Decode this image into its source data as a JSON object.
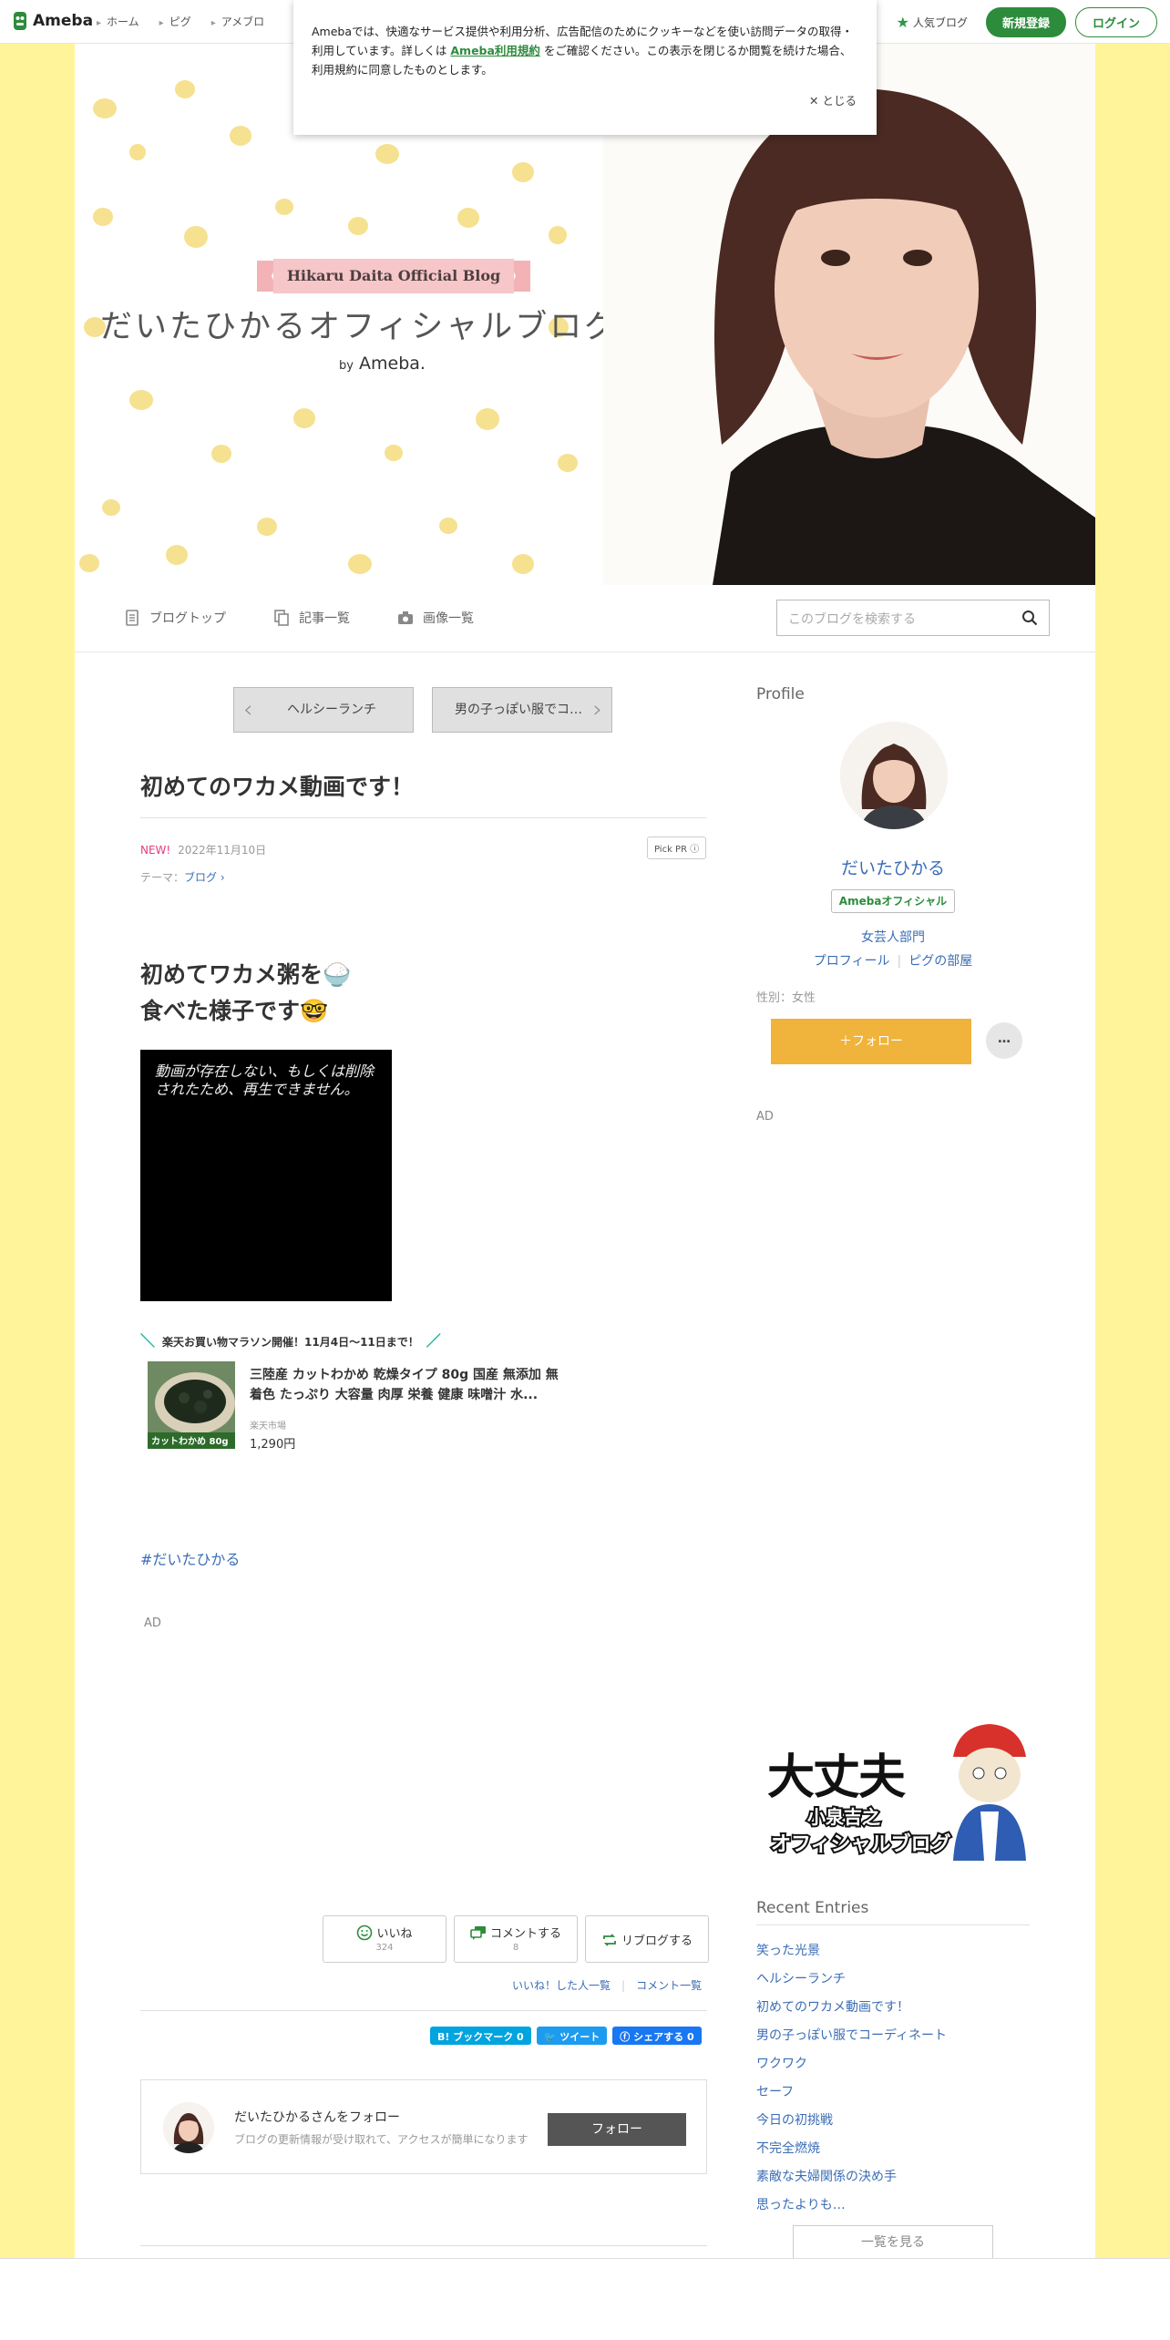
{
  "topbar": {
    "logo": "Ameba",
    "nav": [
      "ホーム",
      "ピグ",
      "アメブロ"
    ],
    "popular": "人気ブログ",
    "signup": "新規登録",
    "login": "ログイン"
  },
  "cookie": {
    "text1": "Amebaでは、快適なサービス提供や利用分析、広告配信のためにクッキーなどを使い訪問データの取得・利用しています。詳しくは",
    "link": "Ameba利用規約",
    "text2": "をご確認ください。この表示を閉じるか閲覧を続けた場合、利用規約に同意したものとします。",
    "close": "✕ とじる"
  },
  "header": {
    "ribbon": "Hikaru Daita Official Blog",
    "title": "だいたひかるオフィシャルブログ",
    "by": "by",
    "ameba": "Ameba."
  },
  "blognav": {
    "top": "ブログトップ",
    "articles": "記事一覧",
    "images": "画像一覧",
    "search_placeholder": "このブログを検索する"
  },
  "entry": {
    "prev": "ヘルシーランチ",
    "next": "男の子っぽい服でコ…",
    "title": "初めてのワカメ動画です！",
    "new": "NEW!",
    "date": "2022年11月10日",
    "pickpr": "Pick PR ⓘ",
    "theme_label": "テーマ：",
    "theme": "ブログ ›",
    "line1": "初めてワカメ粥を🍚",
    "line2": "食べた様子です🤓",
    "video_msg": "動画が存在しない、もしくは削除されたため、再生できません。",
    "rakuten_head": "楽天お買い物マラソン開催！11月4日～11日まで！",
    "product_name": "三陸産 カットわかめ 乾燥タイプ 80g 国産 無添加 無着色 たっぷり 大容量 肉厚 栄養 健康 味噌汁 水...",
    "product_shop": "楽天市場",
    "product_price": "1,290円",
    "product_img_label": "カットわかめ 80g",
    "hashtag": "#だいたひかる",
    "ad": "AD",
    "like": "いいね",
    "like_count": "324",
    "comment": "コメントする",
    "comment_count": "8",
    "reblog": "リブログする",
    "liked_list": "いいね！した人一覧",
    "comment_list": "コメント一覧",
    "hatena": "B! ブックマーク  0",
    "tweet": "ツイート",
    "share": "シェアする 0",
    "follow_title": "だいたひかるさんをフォロー",
    "follow_sub": "ブログの更新情報が受け取れて、アクセスが簡単になります",
    "follow_btn": "フォロー"
  },
  "sidebar": {
    "profile_head": "Profile",
    "name": "だいたひかる",
    "badge": "Amebaオフィシャル",
    "category": "女芸人部門",
    "profile_link": "プロフィール",
    "pig_link": "ピグの部屋",
    "gender": "性別：女性",
    "follow": "＋フォロー",
    "more": "…",
    "ad": "AD",
    "banner1": "大丈夫",
    "banner2": "小泉吉之",
    "banner3": "オフィシャルブログ",
    "recent_head": "Recent Entries",
    "recent": [
      "笑った光景",
      "ヘルシーランチ",
      "初めてのワカメ動画です！",
      "男の子っぽい服でコーディネート",
      "ワクワク",
      "セーフ",
      "今日の初挑戦",
      "不完全燃焼",
      "素敵な夫婦関係の決め手",
      "思ったよりも…"
    ],
    "all": "一覧を見る"
  },
  "colors": {
    "background": "#fff499",
    "accent": "#2d8c3c",
    "follow": "#f0b33b",
    "link": "#3b6db5"
  }
}
